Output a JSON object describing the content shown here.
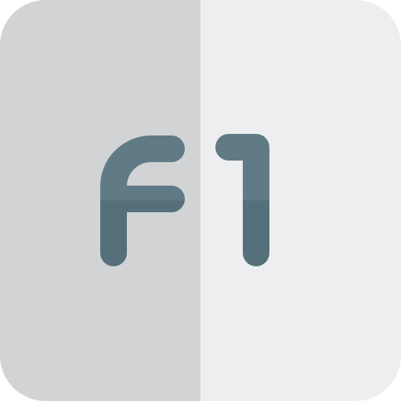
{
  "icon": {
    "name": "f1-key-icon",
    "label": "F1",
    "colors": {
      "key_left": "#d1d3d5",
      "key_right": "#edeef0",
      "glyph_top": "#617b86",
      "glyph_bottom": "#55707a"
    }
  }
}
